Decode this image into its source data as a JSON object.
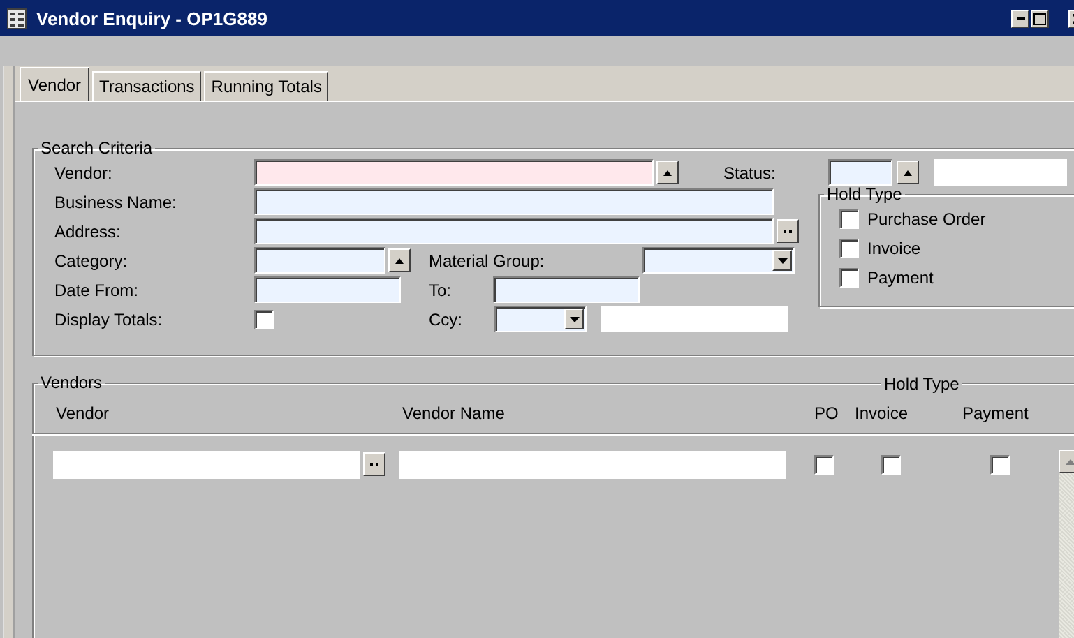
{
  "window": {
    "title": "Vendor Enquiry - OP1G889"
  },
  "tabs": [
    {
      "label": "Vendor",
      "selected": true
    },
    {
      "label": "Transactions",
      "selected": false
    },
    {
      "label": "Running Totals",
      "selected": false
    }
  ],
  "search_criteria": {
    "legend": "Search Criteria",
    "vendor": {
      "label": "Vendor:",
      "required": true
    },
    "status": {
      "label": "Status:"
    },
    "business_name": {
      "label": "Business Name:",
      "required": false
    },
    "address": {
      "label": "Address:",
      "required": false
    },
    "category": {
      "label": "Category:",
      "required": false
    },
    "material_group": {
      "label": "Material Group:"
    },
    "date_from": {
      "label": "Date From:",
      "required": false
    },
    "to": {
      "label": "To:"
    },
    "display_totals": {
      "label": "Display Totals:",
      "checked": false
    },
    "ccy": {
      "label": "Ccy:"
    },
    "hold_type": {
      "legend": "Hold Type",
      "options": [
        {
          "label": "Purchase Order",
          "checked": false
        },
        {
          "label": "Invoice",
          "checked": false
        },
        {
          "label": "Payment",
          "checked": false
        }
      ]
    }
  },
  "vendors": {
    "legend": "Vendors",
    "hold_type_legend": "Hold Type",
    "columns": [
      "Vendor",
      "Vendor Name",
      "PO",
      "Invoice",
      "Payment"
    ],
    "rows": [
      {
        "po": false,
        "invoice": false,
        "payment": false
      }
    ]
  }
}
